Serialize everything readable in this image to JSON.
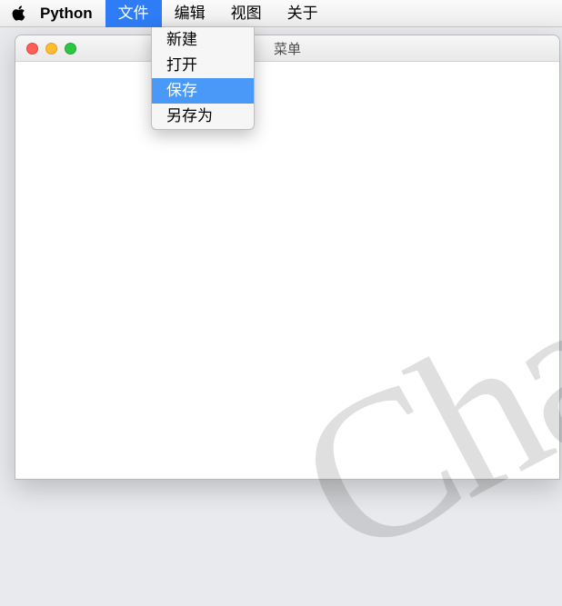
{
  "menubar": {
    "app_name": "Python",
    "items": [
      {
        "label": "文件",
        "active": true
      },
      {
        "label": "编辑",
        "active": false
      },
      {
        "label": "视图",
        "active": false
      },
      {
        "label": "关于",
        "active": false
      }
    ]
  },
  "dropdown": {
    "items": [
      {
        "label": "新建",
        "highlight": false
      },
      {
        "label": "打开",
        "highlight": false
      },
      {
        "label": "保存",
        "highlight": true
      },
      {
        "label": "另存为",
        "highlight": false
      }
    ]
  },
  "window": {
    "title": "菜单"
  },
  "watermark": "Chat"
}
